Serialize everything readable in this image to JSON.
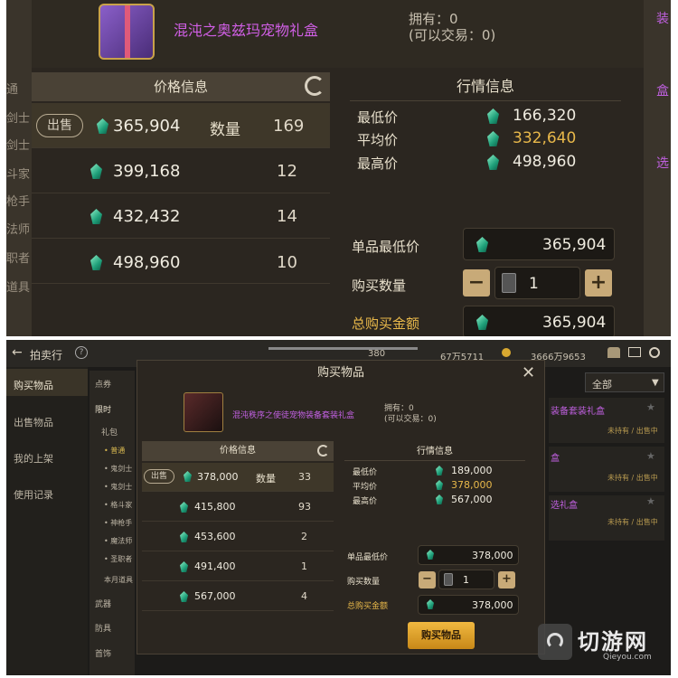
{
  "top": {
    "item_name": "混沌之奥兹玛宠物礼盒",
    "owned": "拥有：0",
    "tradable": "(可以交易：0)",
    "price_header": "价格信息",
    "market_header": "行情信息",
    "sell_label": "出售",
    "qty_label": "数量",
    "listings": [
      {
        "price": "365,904",
        "qty": "169"
      },
      {
        "price": "399,168",
        "qty": "12"
      },
      {
        "price": "432,432",
        "qty": "14"
      },
      {
        "price": "498,960",
        "qty": "10"
      }
    ],
    "market": {
      "min_label": "最低价",
      "min_value": "166,320",
      "avg_label": "平均价",
      "avg_value": "332,640",
      "max_label": "最高价",
      "max_value": "498,960"
    },
    "unit_min_label": "单品最低价",
    "unit_min_value": "365,904",
    "buy_qty_label": "购买数量",
    "buy_qty_value": "1",
    "total_label": "总购买金额",
    "total_value": "365,904",
    "edge_left": [
      "通",
      "剑士",
      "剑士",
      "斗家",
      "枪手",
      "法师",
      "职者",
      "道具"
    ],
    "edge_right": [
      "装",
      "盒",
      "选"
    ]
  },
  "bottom": {
    "back_title": "拍卖行",
    "help": "?",
    "currency1": "380",
    "currency2": "67万5711",
    "currency3": "3666万9653",
    "sidebar": [
      "购买物品",
      "出售物品",
      "我的上架",
      "使用记录"
    ],
    "subnav": [
      "点券",
      "限时",
      "礼包",
      "• 普通",
      "• 鬼剑士",
      "• 鬼剑士",
      "• 格斗家",
      "• 神枪手",
      "• 魔法师",
      "• 圣职者",
      "本月道具",
      "武器",
      "防具",
      "首饰"
    ],
    "dropdown": "全部",
    "right_list": [
      {
        "name": "装备套装礼盒",
        "status": "未持有 / 出售中"
      },
      {
        "name": "盒",
        "status": "未持有 / 出售中"
      },
      {
        "name": "选礼盒",
        "status": "未持有 / 出售中"
      }
    ],
    "modal_title": "购买物品",
    "item_name": "混沌秩序之使徒宠物装备套装礼盒",
    "owned": "拥有：0",
    "tradable": "(可以交易：0)",
    "price_header": "价格信息",
    "market_header": "行情信息",
    "sell_label": "出售",
    "qty_label": "数量",
    "listings": [
      {
        "price": "378,000",
        "qty": "33"
      },
      {
        "price": "415,800",
        "qty": "93"
      },
      {
        "price": "453,600",
        "qty": "2"
      },
      {
        "price": "491,400",
        "qty": "1"
      },
      {
        "price": "567,000",
        "qty": "4"
      }
    ],
    "market": {
      "min_label": "最低价",
      "min_value": "189,000",
      "avg_label": "平均价",
      "avg_value": "378,000",
      "max_label": "最高价",
      "max_value": "567,000"
    },
    "unit_min_label": "单品最低价",
    "unit_min_value": "378,000",
    "buy_qty_label": "购买数量",
    "buy_qty_value": "1",
    "total_label": "总购买金额",
    "total_value": "378,000",
    "buy_button": "购买物品",
    "watermark_cn": "切游网",
    "watermark_en": "Qieyou.com"
  }
}
